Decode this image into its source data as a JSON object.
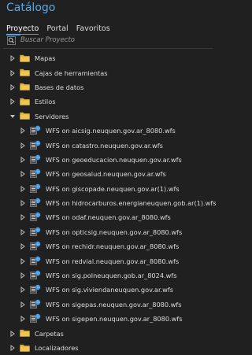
{
  "title": "Catálogo",
  "tabs": [
    {
      "label": "Proyecto",
      "active": true
    },
    {
      "label": "Portal",
      "active": false
    },
    {
      "label": "Favoritos",
      "active": false
    }
  ],
  "search": {
    "placeholder": "Buscar Proyecto",
    "value": ""
  },
  "colors": {
    "accent": "#3fa9f5",
    "title": "#59a9e6",
    "folder": "#e2b640",
    "background": "#202020"
  },
  "tree": [
    {
      "label": "Mapas",
      "icon": "map-folder-icon",
      "expanded": false
    },
    {
      "label": "Cajas de herramientas",
      "icon": "toolbox-folder-icon",
      "expanded": false
    },
    {
      "label": "Bases de datos",
      "icon": "database-folder-icon",
      "expanded": false
    },
    {
      "label": "Estilos",
      "icon": "styles-folder-icon",
      "expanded": false
    },
    {
      "label": "Servidores",
      "icon": "servers-folder-icon",
      "expanded": true,
      "children": [
        "WFS on aicsig.neuquen.gov.ar_8080.wfs",
        "WFS on catastro.neuquen.gov.ar.wfs",
        "WFS on geoeducacion.neuquen.gov.ar.wfs",
        "WFS on geosalud.neuquen.gov.ar.wfs",
        "WFS on giscopade.neuquen.gov.ar(1).wfs",
        "WFS on hidrocarburos.energianeuquen.gob.ar(1).wfs",
        "WFS on odaf.neuquen.gov.ar_8080.wfs",
        "WFS on opticsig.neuquen.gov.ar_8080.wfs",
        "WFS on rechidr.neuquen.gov.ar_8080.wfs",
        "WFS on redvial.neuquen.gov.ar_8080.wfs",
        "WFS on sig.polneuquen.gob.ar_8024.wfs",
        "WFS on sig.viviendaneuquen.gov.ar.wfs",
        "WFS on sigepas.neuquen.gov.ar_8080.wfs",
        "WFS on sigepen.neuquen.gov.ar_8080.wfs"
      ]
    },
    {
      "label": "Carpetas",
      "icon": "folders-icon",
      "expanded": false
    },
    {
      "label": "Localizadores",
      "icon": "locators-folder-icon",
      "expanded": false
    }
  ]
}
